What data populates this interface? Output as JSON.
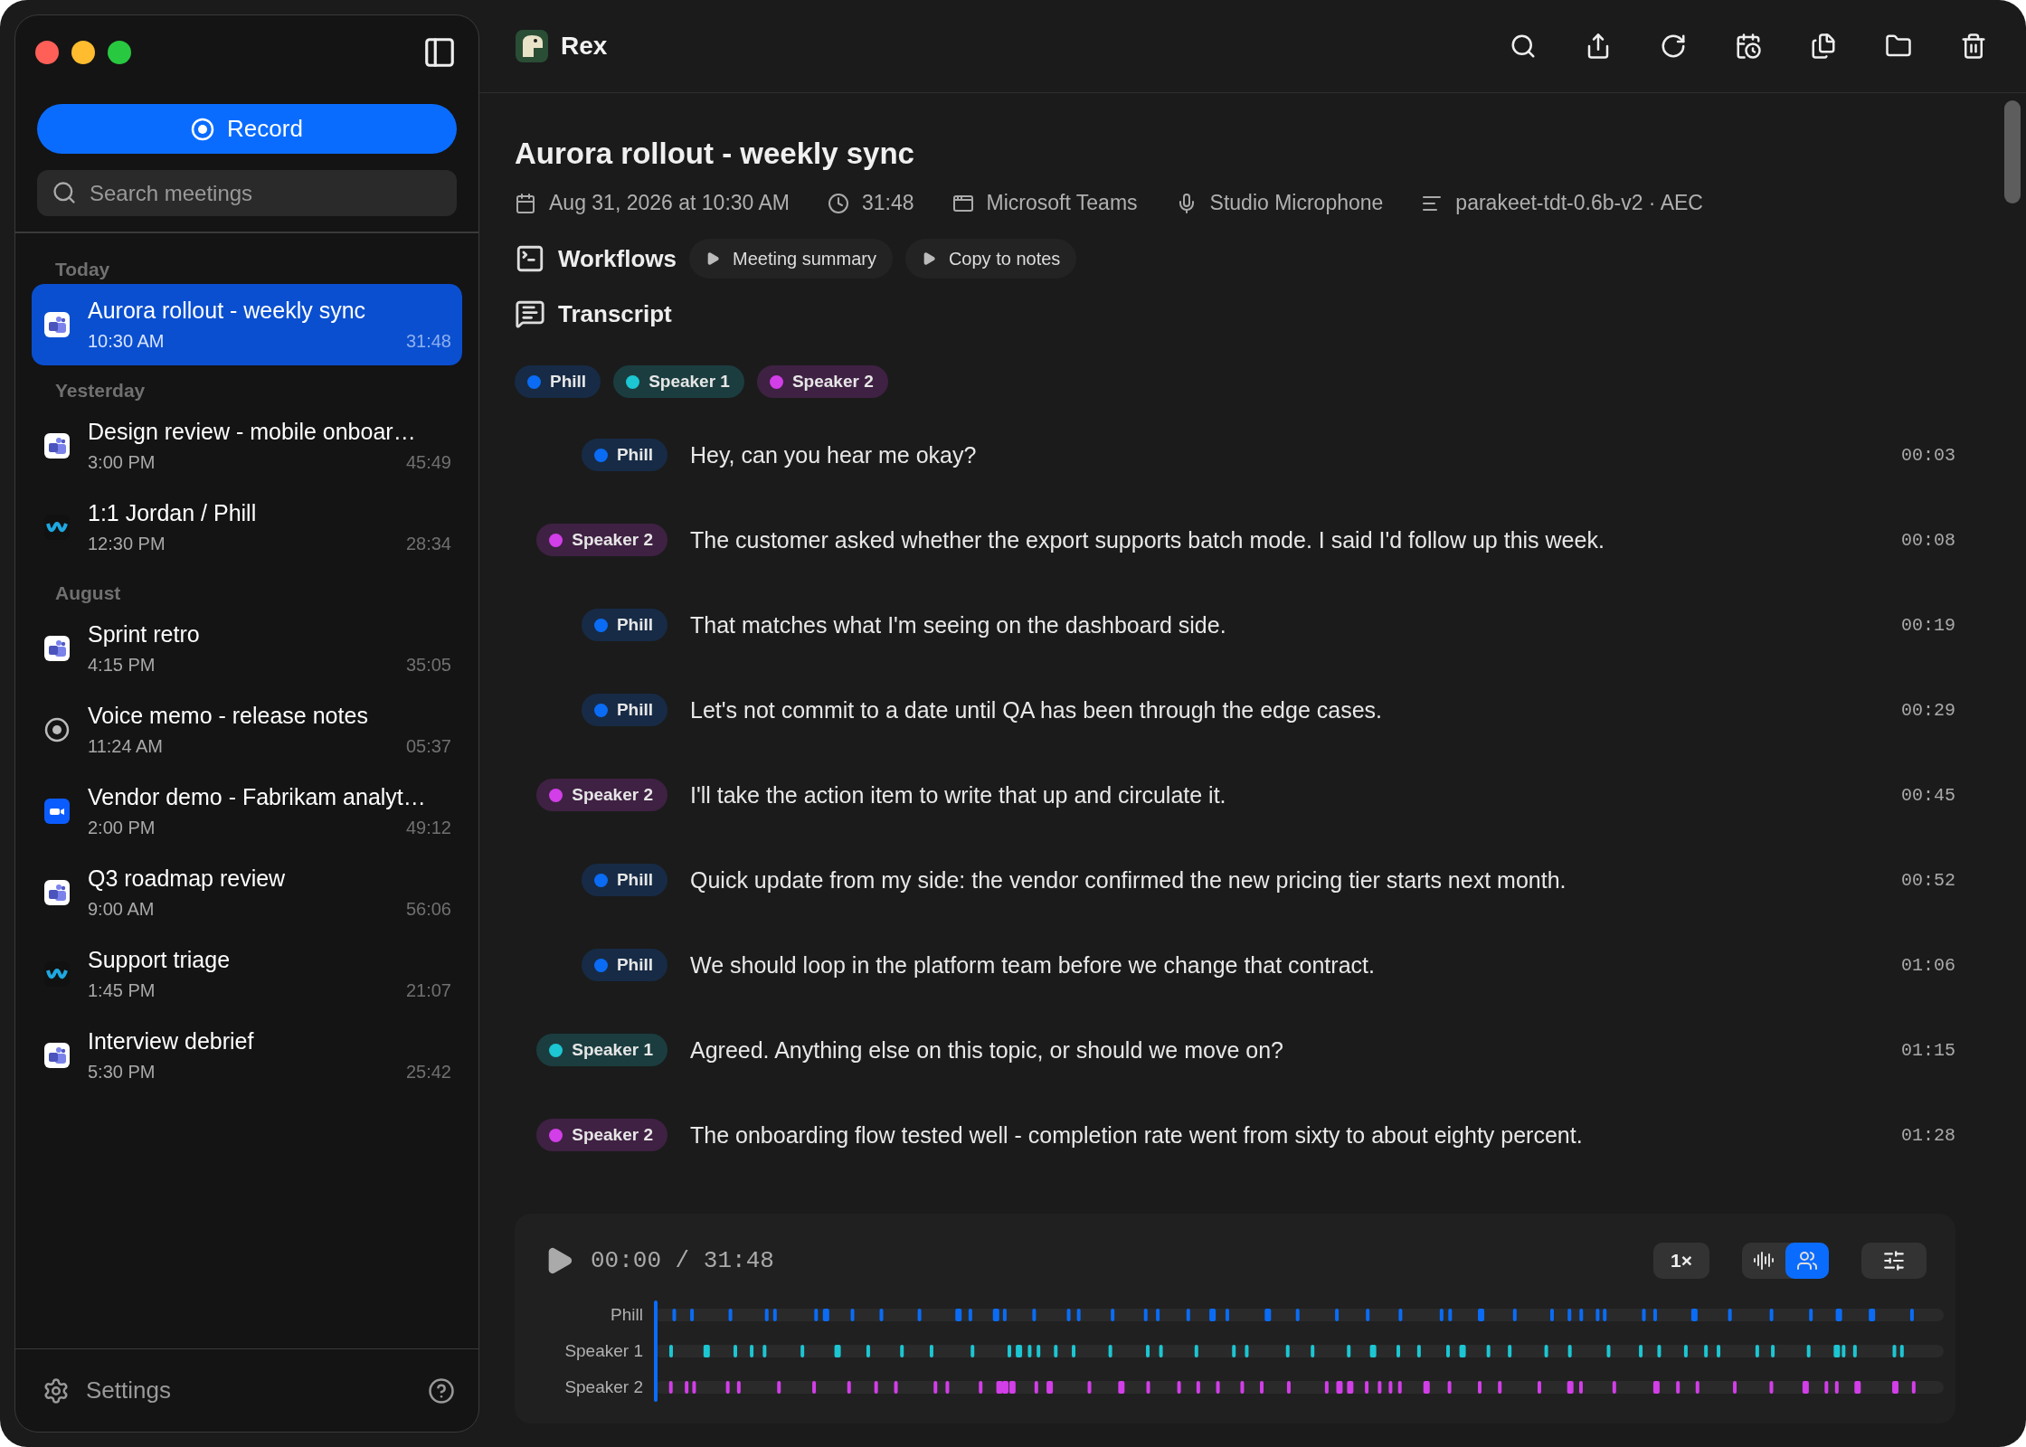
{
  "sidebar": {
    "record_button": "Record",
    "search": {
      "placeholder": "Search meetings"
    },
    "sections": [
      {
        "title": "Today",
        "items": [
          {
            "title": "Aurora rollout - weekly sync",
            "time": "10:30 AM",
            "duration": "31:48",
            "kind": "teams",
            "selected": true
          }
        ]
      },
      {
        "title": "Yesterday",
        "items": [
          {
            "title": "Design review - mobile onboar…",
            "time": "3:00 PM",
            "duration": "45:49",
            "kind": "teams",
            "selected": false
          },
          {
            "title": "1:1 Jordan / Phill",
            "time": "12:30 PM",
            "duration": "28:34",
            "kind": "webex",
            "selected": false
          }
        ]
      },
      {
        "title": "August",
        "items": [
          {
            "title": "Sprint retro",
            "time": "4:15 PM",
            "duration": "35:05",
            "kind": "teams",
            "selected": false
          },
          {
            "title": "Voice memo - release notes",
            "time": "11:24 AM",
            "duration": "05:37",
            "kind": "voice",
            "selected": false
          },
          {
            "title": "Vendor demo - Fabrikam analyt…",
            "time": "2:00 PM",
            "duration": "49:12",
            "kind": "zoom",
            "selected": false
          },
          {
            "title": "Q3 roadmap review",
            "time": "9:00 AM",
            "duration": "56:06",
            "kind": "teams",
            "selected": false
          },
          {
            "title": "Support triage",
            "time": "1:45 PM",
            "duration": "21:07",
            "kind": "webex",
            "selected": false
          },
          {
            "title": "Interview debrief",
            "time": "5:30 PM",
            "duration": "25:42",
            "kind": "teams",
            "selected": false
          }
        ]
      }
    ],
    "settings": "Settings"
  },
  "app": {
    "name": "Rex"
  },
  "meeting": {
    "title": "Aurora rollout - weekly sync",
    "meta": [
      {
        "kind": "date",
        "text": "Aug 31, 2026 at 10:30 AM"
      },
      {
        "kind": "duration",
        "text": "31:48"
      },
      {
        "kind": "app",
        "text": "Microsoft Teams"
      },
      {
        "kind": "mic",
        "text": "Studio Microphone"
      },
      {
        "kind": "model",
        "text": "parakeet-tdt-0.6b-v2 · AEC"
      }
    ],
    "workflows": {
      "title": "Workflows",
      "actions": [
        "Meeting summary",
        "Copy to notes"
      ]
    },
    "transcript": {
      "title": "Transcript",
      "speakers": [
        {
          "name": "Phill",
          "color": "#0a6cf5"
        },
        {
          "name": "Speaker 1",
          "color": "#1cc6d2"
        },
        {
          "name": "Speaker 2",
          "color": "#d23ee8"
        }
      ],
      "lines": [
        {
          "speaker": "Phill",
          "color": "#0a6cf5",
          "text": "Hey, can you hear me okay?",
          "time": "00:03"
        },
        {
          "speaker": "Speaker 2",
          "color": "#d23ee8",
          "text": "The customer asked whether the export supports batch mode. I said I'd follow up this week.",
          "time": "00:08"
        },
        {
          "speaker": "Phill",
          "color": "#0a6cf5",
          "text": "That matches what I'm seeing on the dashboard side.",
          "time": "00:19"
        },
        {
          "speaker": "Phill",
          "color": "#0a6cf5",
          "text": "Let's not commit to a date until QA has been through the edge cases.",
          "time": "00:29"
        },
        {
          "speaker": "Speaker 2",
          "color": "#d23ee8",
          "text": "I'll take the action item to write that up and circulate it.",
          "time": "00:45"
        },
        {
          "speaker": "Phill",
          "color": "#0a6cf5",
          "text": "Quick update from my side: the vendor confirmed the new pricing tier starts next month.",
          "time": "00:52"
        },
        {
          "speaker": "Phill",
          "color": "#0a6cf5",
          "text": "We should loop in the platform team before we change that contract.",
          "time": "01:06"
        },
        {
          "speaker": "Speaker 1",
          "color": "#1cc6d2",
          "text": "Agreed. Anything else on this topic, or should we move on?",
          "time": "01:15"
        },
        {
          "speaker": "Speaker 2",
          "color": "#d23ee8",
          "text": "The onboarding flow tested well - completion rate went from sixty to about eighty percent.",
          "time": "01:28"
        }
      ]
    }
  },
  "player": {
    "time": "00:00 / 31:48",
    "speed": "1×",
    "view_modes": [
      {
        "kind": "waveform",
        "selected": false
      },
      {
        "kind": "speakers",
        "selected": true
      }
    ],
    "tracks": [
      {
        "label": "Phill",
        "color": "#0a6cf5"
      },
      {
        "label": "Speaker 1",
        "color": "#1cc6d2"
      },
      {
        "label": "Speaker 2",
        "color": "#d23ee8"
      }
    ]
  }
}
